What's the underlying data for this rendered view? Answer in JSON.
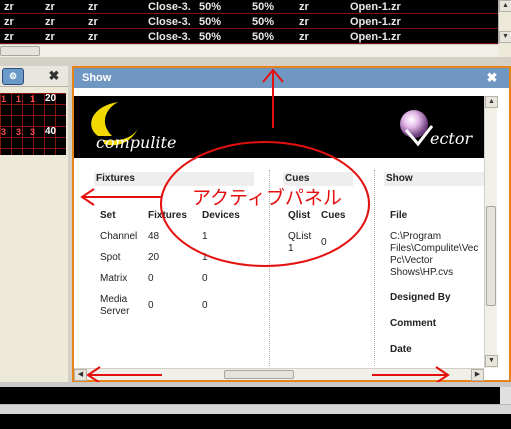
{
  "top_table": {
    "rows": [
      [
        "zr",
        "zr",
        "zr",
        "Close-3.",
        "50%",
        "50%",
        "zr",
        "Open-1.zr"
      ],
      [
        "zr",
        "zr",
        "zr",
        "Close-3.",
        "50%",
        "50%",
        "zr",
        "Open-1.zr"
      ],
      [
        "zr",
        "zr",
        "zr",
        "Close-3.",
        "50%",
        "50%",
        "zr",
        "Open-1.zr"
      ]
    ]
  },
  "left_panel": {
    "icon_label": "⚙",
    "close": "✖",
    "row1_cells": [
      "1",
      "1",
      "1"
    ],
    "row1_number": "20",
    "row2_cells": [
      "3",
      "3",
      "3"
    ],
    "row2_number": "40"
  },
  "show_panel": {
    "title": "Show",
    "close": "✖",
    "logo_text": "compulite",
    "vector_text": "ector",
    "fixtures": {
      "header": "Fixtures",
      "col_set": "Set",
      "col_fixtures": "Fixtures",
      "col_devices": "Devices",
      "rows": [
        {
          "set": "Channel",
          "fixtures": "48",
          "devices": "1"
        },
        {
          "set": "Spot",
          "fixtures": "20",
          "devices": "1"
        },
        {
          "set": "Matrix",
          "fixtures": "0",
          "devices": "0"
        },
        {
          "set": "Media\nServer",
          "fixtures": "0",
          "devices": "0"
        }
      ]
    },
    "cues": {
      "header": "Cues",
      "col_qlist": "Qlist",
      "col_cues": "Cues",
      "rows": [
        {
          "qlist": "QList\n1",
          "cues": "0"
        }
      ]
    },
    "show": {
      "header": "Show",
      "file_label": "File",
      "file_value": "C:\\Program\nFiles\\Compulite\\Vec\nPc\\Vector\nShows\\HP.cvs",
      "designed_by_label": "Designed By",
      "comment_label": "Comment",
      "date_label": "Date"
    }
  },
  "annotation": {
    "text": "アクティブパネル",
    "color": "#e41010"
  },
  "colors": {
    "panel_border": "#e8831a",
    "title_bar": "#7097c2",
    "grid_line": "#961414"
  }
}
